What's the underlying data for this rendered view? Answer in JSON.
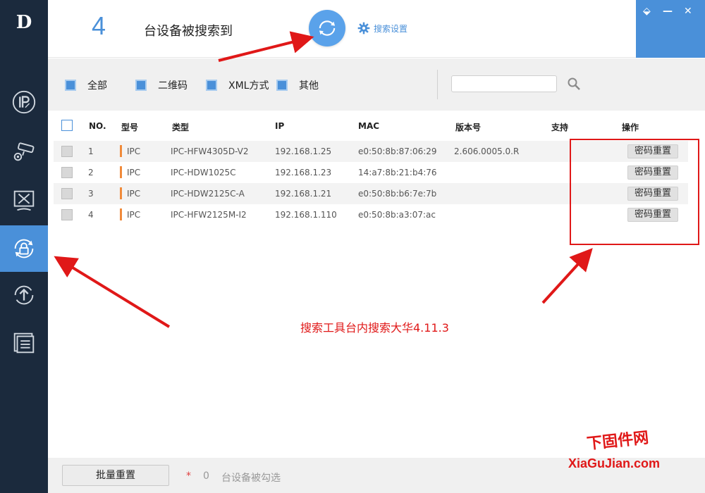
{
  "logo": "D",
  "header": {
    "device_count": "4",
    "count_label": "台设备被搜索到",
    "search_settings_label": "搜索设置"
  },
  "window_controls": [
    "⬙",
    "—",
    "✕"
  ],
  "filters": [
    {
      "label": "全部"
    },
    {
      "label": "二维码"
    },
    {
      "label": "XML方式"
    },
    {
      "label": "其他"
    }
  ],
  "search": {
    "value": "",
    "placeholder": ""
  },
  "table": {
    "headers": [
      "NO.",
      "型号",
      "类型",
      "IP",
      "MAC",
      "版本号",
      "支持",
      "操作"
    ],
    "rows": [
      {
        "no": "1",
        "model": "IPC",
        "type": "IPC-HFW4305D-V2",
        "ip": "192.168.1.25",
        "mac": "e0:50:8b:87:06:29",
        "version": "2.606.0005.0.R",
        "action": "密码重置"
      },
      {
        "no": "2",
        "model": "IPC",
        "type": "IPC-HDW1025C",
        "ip": "192.168.1.23",
        "mac": "14:a7:8b:21:b4:76",
        "version": "",
        "action": "密码重置"
      },
      {
        "no": "3",
        "model": "IPC",
        "type": "IPC-HDW2125C-A",
        "ip": "192.168.1.21",
        "mac": "e0:50:8b:b6:7e:7b",
        "version": "",
        "action": "密码重置"
      },
      {
        "no": "4",
        "model": "IPC",
        "type": "IPC-HFW2125M-I2",
        "ip": "192.168.1.110",
        "mac": "e0:50:8b:a3:07:ac",
        "version": "",
        "action": "密码重置"
      }
    ]
  },
  "annotation": "搜索工具台内搜索大华4.11.3",
  "footer": {
    "batch_reset_label": "批量重置",
    "star": "*",
    "selected_count": "0",
    "selected_label": "台设备被勾选"
  },
  "watermark": {
    "line1": "下固件网",
    "line2": "XiaGuJian.com"
  },
  "colors": {
    "accent": "#4a90d9",
    "sidebar": "#1b2a3d",
    "annotation": "#e01818",
    "model_bar": "#f08a3a"
  }
}
